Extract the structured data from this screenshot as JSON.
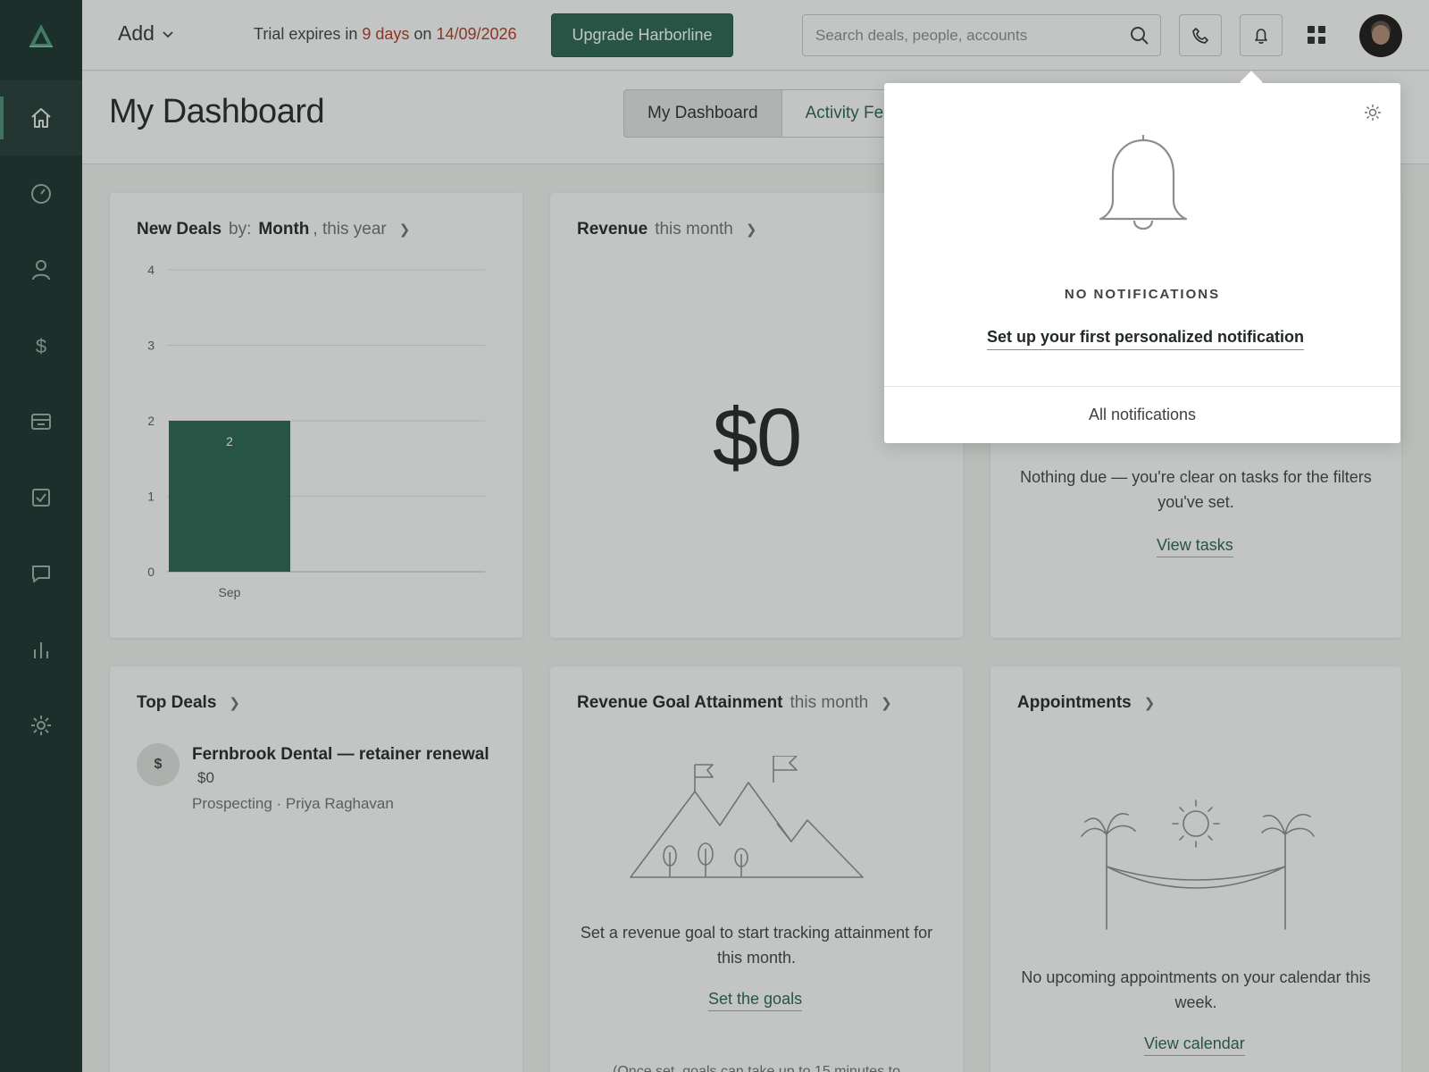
{
  "topbar": {
    "add_label": "Add",
    "trial_prefix": "Trial expires in ",
    "trial_days": "9 days",
    "trial_on": " on ",
    "trial_date": "14/09/2026",
    "upgrade_label": "Upgrade Harborline",
    "search_placeholder": "Search deals, people, accounts"
  },
  "sidebar": {
    "items": [
      {
        "icon": "home-icon",
        "active": true
      },
      {
        "icon": "dashboard-gauge-icon"
      },
      {
        "icon": "person-icon"
      },
      {
        "icon": "dollar-icon"
      },
      {
        "icon": "inbox-icon"
      },
      {
        "icon": "checkbox-icon"
      },
      {
        "icon": "chat-icon"
      },
      {
        "icon": "bar-chart-icon"
      },
      {
        "icon": "gear-icon"
      }
    ]
  },
  "header": {
    "title": "My Dashboard",
    "tabs": [
      {
        "label": "My Dashboard",
        "active": true
      },
      {
        "label": "Activity Fe"
      }
    ]
  },
  "new_deals": {
    "title": "New Deals",
    "by": "by:",
    "period": "Month",
    "suffix": ", this year"
  },
  "revenue": {
    "title": "Revenue",
    "suffix": "this month",
    "value": "$0"
  },
  "tasks": {
    "empty_text": "Nothing due — you're clear on tasks for the filters you've set.",
    "link": "View tasks"
  },
  "top_deals": {
    "title": "Top Deals",
    "deal_icon": "$",
    "deal_name": "Fernbrook Dental — retainer renewal",
    "deal_value": "$0",
    "deal_meta": "Prospecting · Priya Raghavan"
  },
  "goal": {
    "title": "Revenue Goal Attainment",
    "suffix": "this month",
    "empty_text": "Set a revenue goal to start tracking attainment for this month.",
    "link": "Set the goals",
    "note": "(Once set, goals can take up to 15 minutes to"
  },
  "appointments": {
    "title": "Appointments",
    "empty_text": "No upcoming appointments on your calendar this week.",
    "link": "View calendar"
  },
  "notifications": {
    "heading": "NO NOTIFICATIONS",
    "setup_link": "Set up your first personalized notification",
    "all_link": "All notifications"
  },
  "chart_data": {
    "type": "bar",
    "categories": [
      "Sep"
    ],
    "values": [
      2
    ],
    "data_labels": [
      "2"
    ],
    "y_ticks": [
      0,
      1,
      2,
      3,
      4
    ],
    "ylim": [
      0,
      4
    ],
    "grid": true,
    "color": "#286350"
  }
}
